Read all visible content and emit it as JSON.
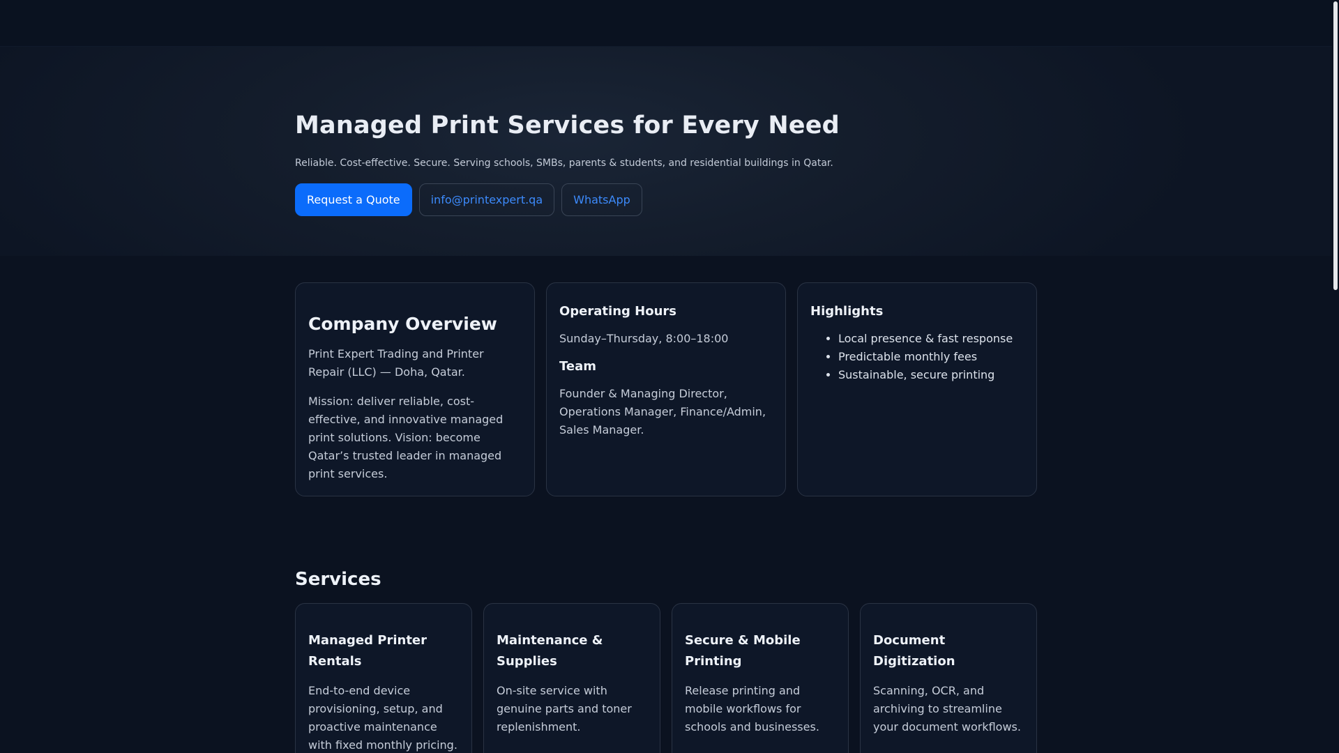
{
  "hero": {
    "title": "Managed Print Services for Every Need",
    "subtitle": "Reliable. Cost-effective. Secure. Serving schools, SMBs, parents & students, and residential buildings in Qatar.",
    "buttons": {
      "quote": "Request a Quote",
      "email": "info@printexpert.qa",
      "whatsapp": "WhatsApp"
    }
  },
  "overview": {
    "title": "Company Overview",
    "company": "Print Expert Trading and Printer Repair (LLC) — Doha, Qatar.",
    "mission": "Mission: deliver reliable, cost-effective, and innovative managed print solutions. Vision: become Qatar’s trusted leader in managed print services."
  },
  "hours": {
    "title": "Operating Hours",
    "text": "Sunday–Thursday, 8:00–18:00",
    "team_title": "Team",
    "team_text": "Founder & Managing Director, Operations Manager, Finance/Admin, Sales Manager."
  },
  "highlights": {
    "title": "Highlights",
    "items": [
      "Local presence & fast response",
      "Predictable monthly fees",
      "Sustainable, secure printing"
    ]
  },
  "services": {
    "title": "Services",
    "items": [
      {
        "title": "Managed Printer Rentals",
        "desc": "End-to-end device provisioning, setup, and proactive maintenance with fixed monthly pricing."
      },
      {
        "title": "Maintenance & Supplies",
        "desc": "On-site service with genuine parts and toner replenishment."
      },
      {
        "title": "Secure & Mobile Printing",
        "desc": "Release printing and mobile workflows for schools and businesses."
      },
      {
        "title": "Document Digitization",
        "desc": "Scanning, OCR, and archiving to streamline your document workflows."
      }
    ]
  }
}
